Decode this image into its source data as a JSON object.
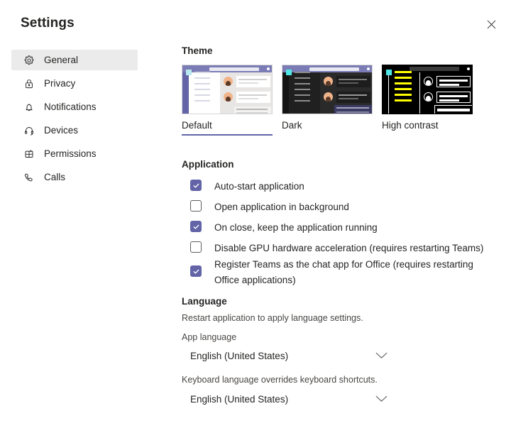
{
  "window": {
    "title": "Settings",
    "close_label": "Close"
  },
  "sidebar": {
    "items": [
      {
        "id": "general",
        "label": "General",
        "icon": "gear-icon",
        "selected": true
      },
      {
        "id": "privacy",
        "label": "Privacy",
        "icon": "lock-icon",
        "selected": false
      },
      {
        "id": "notifications",
        "label": "Notifications",
        "icon": "bell-icon",
        "selected": false
      },
      {
        "id": "devices",
        "label": "Devices",
        "icon": "headset-icon",
        "selected": false
      },
      {
        "id": "permissions",
        "label": "Permissions",
        "icon": "grid-plus-icon",
        "selected": false
      },
      {
        "id": "calls",
        "label": "Calls",
        "icon": "phone-icon",
        "selected": false
      }
    ]
  },
  "theme": {
    "heading": "Theme",
    "options": [
      {
        "id": "default",
        "label": "Default",
        "selected": true
      },
      {
        "id": "dark",
        "label": "Dark",
        "selected": false
      },
      {
        "id": "high-contrast",
        "label": "High contrast",
        "selected": false
      }
    ]
  },
  "application": {
    "heading": "Application",
    "checkboxes": [
      {
        "id": "auto-start",
        "label": "Auto-start application",
        "checked": true
      },
      {
        "id": "open-background",
        "label": "Open application in background",
        "checked": false
      },
      {
        "id": "keep-running",
        "label": "On close, keep the application running",
        "checked": true
      },
      {
        "id": "disable-gpu",
        "label": "Disable GPU hardware acceleration (requires restarting Teams)",
        "checked": false
      },
      {
        "id": "register-chat-app",
        "label": "Register Teams as the chat app for Office (requires restarting Office applications)",
        "checked": true
      }
    ]
  },
  "language": {
    "heading": "Language",
    "restart_note": "Restart application to apply language settings.",
    "app_language_label": "App language",
    "app_language_value": "English (United States)",
    "keyboard_note": "Keyboard language overrides keyboard shortcuts.",
    "keyboard_language_value": "English (United States)"
  },
  "colors": {
    "accent": "#6264a7",
    "selected_row": "#ebebeb",
    "text": "#252423",
    "subtle_text": "#484644",
    "high_contrast_yellow": "#ffff00"
  }
}
